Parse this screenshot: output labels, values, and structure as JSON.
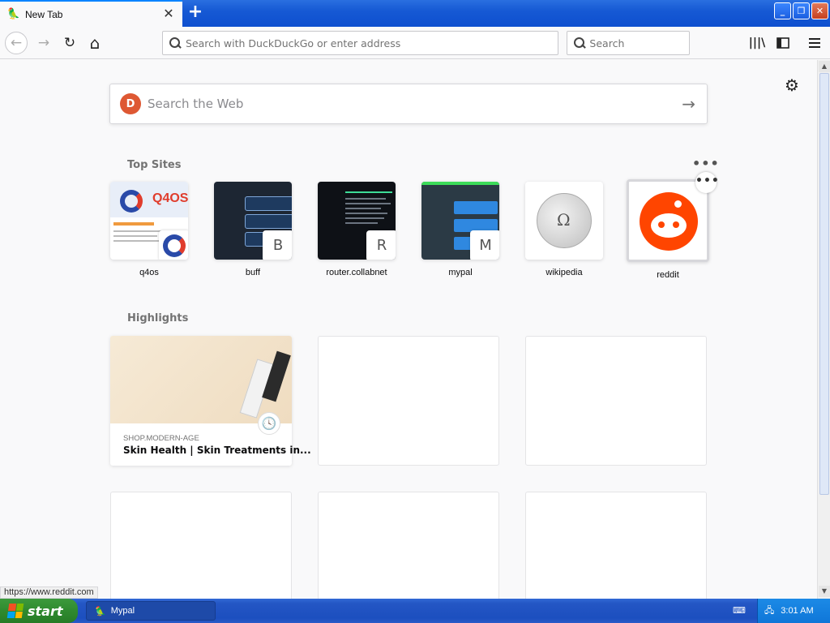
{
  "browser": {
    "tab": {
      "title": "New Tab",
      "close_glyph": "✕"
    },
    "new_tab_glyph": "+",
    "window_buttons": {
      "minimize": "_",
      "restore": "❐",
      "close": "✕"
    },
    "nav": {
      "back": "←",
      "forward": "→",
      "reload": "↻",
      "home": "⌂"
    },
    "urlbar": {
      "placeholder": "Search with DuckDuckGo or enter address",
      "value": ""
    },
    "searchbar": {
      "placeholder": "Search",
      "value": ""
    },
    "toolbar_icons": [
      "library-icon",
      "sidebar-icon",
      "menu-icon"
    ]
  },
  "newtab": {
    "websearch": {
      "placeholder": "Search the Web",
      "arrow": "→"
    },
    "gear_glyph": "⚙",
    "top_sites_title": "Top Sites",
    "ellipsis": "•••",
    "top_sites": [
      {
        "label": "q4os",
        "badge": ""
      },
      {
        "label": "buff",
        "badge": "B"
      },
      {
        "label": "router.collabnet",
        "badge": "R"
      },
      {
        "label": "mypal",
        "badge": "M"
      },
      {
        "label": "wikipedia",
        "badge": ""
      },
      {
        "label": "reddit",
        "badge": ""
      }
    ],
    "highlights_title": "Highlights",
    "highlight": {
      "source": "SHOP.MODERN-AGE",
      "title": "Skin Health | Skin Treatments in...",
      "clock": "🕓"
    }
  },
  "status_url": "https://www.reddit.com",
  "taskbar": {
    "start_label": "start",
    "task_label": "Mypal",
    "clock": "3:01 AM"
  },
  "colors": {
    "accent": "#0a84ff",
    "reddit": "#ff4500",
    "ddg": "#de5833",
    "xp_blue": "#245edb",
    "xp_green": "#3c9a3c"
  }
}
